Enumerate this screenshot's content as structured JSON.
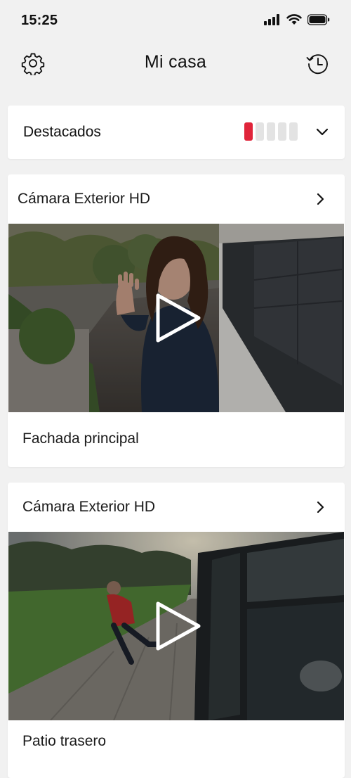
{
  "status_bar": {
    "time": "15:25"
  },
  "header": {
    "title": "Mi casa"
  },
  "highlights": {
    "label": "Destacados",
    "signal_level": 1,
    "signal_total": 5,
    "signal_color": "#e0243a"
  },
  "cameras": [
    {
      "device_name": "Cámara Exterior HD",
      "feed_label": "Fachada principal"
    },
    {
      "device_name": "Cámara Exterior HD",
      "feed_label": "Patio trasero"
    }
  ]
}
